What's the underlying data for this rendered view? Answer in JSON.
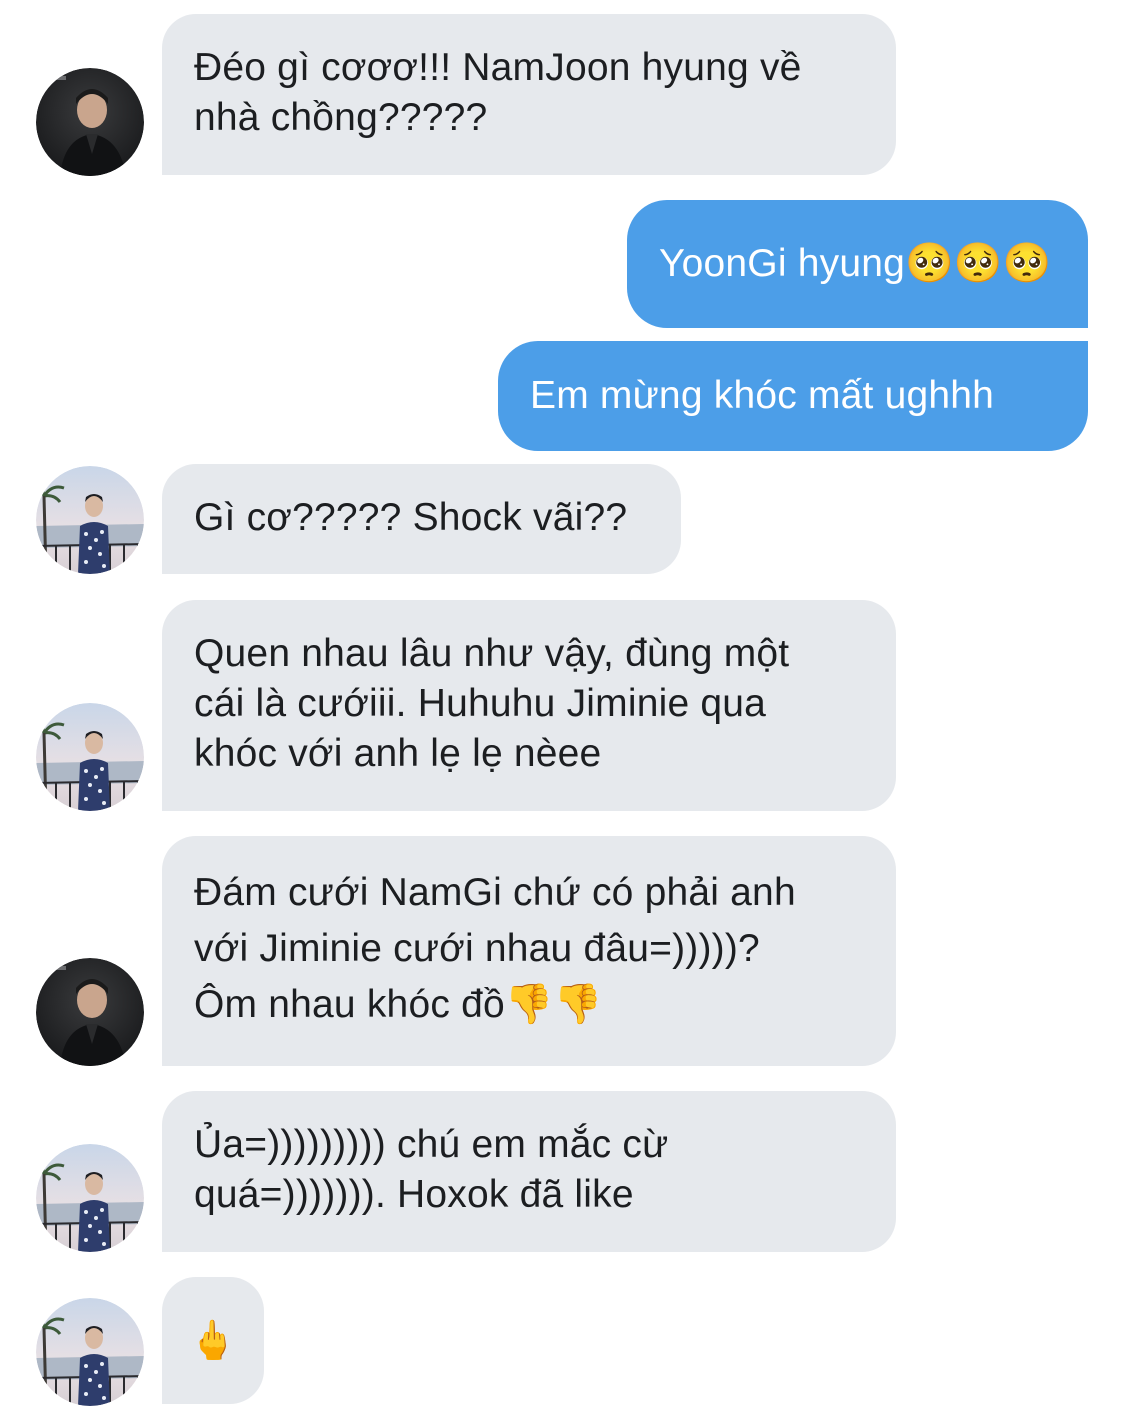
{
  "colors": {
    "incoming_bubble": "#e6e9ed",
    "outgoing_bubble": "#4c9ee8",
    "incoming_text": "#1c1e21",
    "outgoing_text": "#ffffff"
  },
  "messages": [
    {
      "direction": "incoming",
      "avatar": "dark-portrait",
      "text": "Đéo gì cơơơ!!! NamJoon hyung về\nnhà chồng?????"
    },
    {
      "direction": "outgoing",
      "text": "YoonGi hyung🥺🥺🥺"
    },
    {
      "direction": "outgoing",
      "text": "Em mừng khóc mất ughhh"
    },
    {
      "direction": "incoming",
      "avatar": "beach-portrait",
      "text": "Gì cơ????? Shock vãi??"
    },
    {
      "direction": "incoming",
      "avatar": "beach-portrait",
      "text": "Quen nhau lâu như vậy, đùng một\ncái là cướiii. Huhuhu Jiminie qua\nkhóc với anh lẹ lẹ nèee"
    },
    {
      "direction": "incoming",
      "avatar": "dark-portrait",
      "text": "Đám cưới NamGi chứ có phải anh\nvới Jiminie cưới nhau đâu=)))))?\nÔm nhau khóc đồ👎👎"
    },
    {
      "direction": "incoming",
      "avatar": "beach-portrait",
      "text": "Ủa=))))))))) chú em mắc cừ\nquá=))))))). Hoxok đã like"
    },
    {
      "direction": "incoming",
      "avatar": "beach-portrait",
      "text": "🖕"
    }
  ]
}
